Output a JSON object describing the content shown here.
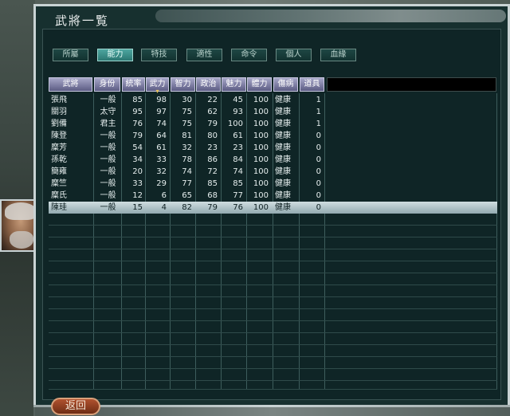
{
  "window": {
    "title": "武將一覧"
  },
  "tabs": [
    {
      "label": "所屬",
      "active": false
    },
    {
      "label": "能力",
      "active": true
    },
    {
      "label": "特技",
      "active": false
    },
    {
      "label": "適性",
      "active": false
    },
    {
      "label": "命令",
      "active": false
    },
    {
      "label": "個人",
      "active": false
    },
    {
      "label": "血緣",
      "active": false
    }
  ],
  "table": {
    "headers": [
      "武將",
      "身份",
      "統率",
      "武力",
      "智力",
      "政治",
      "魅力",
      "體力",
      "傷病",
      "道具"
    ],
    "sorted_column": "武力",
    "rows": [
      {
        "name": "張飛",
        "rank": "一般",
        "lead": "85",
        "war": "98",
        "int": "30",
        "pol": "22",
        "cha": "45",
        "hp": "100",
        "sick": "健康",
        "item": "1"
      },
      {
        "name": "關羽",
        "rank": "太守",
        "lead": "95",
        "war": "97",
        "int": "75",
        "pol": "62",
        "cha": "93",
        "hp": "100",
        "sick": "健康",
        "item": "1"
      },
      {
        "name": "劉備",
        "rank": "君主",
        "lead": "76",
        "war": "74",
        "int": "75",
        "pol": "79",
        "cha": "100",
        "hp": "100",
        "sick": "健康",
        "item": "1"
      },
      {
        "name": "陳登",
        "rank": "一般",
        "lead": "79",
        "war": "64",
        "int": "81",
        "pol": "80",
        "cha": "61",
        "hp": "100",
        "sick": "健康",
        "item": "0"
      },
      {
        "name": "糜芳",
        "rank": "一般",
        "lead": "54",
        "war": "61",
        "int": "32",
        "pol": "23",
        "cha": "23",
        "hp": "100",
        "sick": "健康",
        "item": "0"
      },
      {
        "name": "孫乾",
        "rank": "一般",
        "lead": "34",
        "war": "33",
        "int": "78",
        "pol": "86",
        "cha": "84",
        "hp": "100",
        "sick": "健康",
        "item": "0"
      },
      {
        "name": "簡雍",
        "rank": "一般",
        "lead": "20",
        "war": "32",
        "int": "74",
        "pol": "72",
        "cha": "74",
        "hp": "100",
        "sick": "健康",
        "item": "0"
      },
      {
        "name": "糜竺",
        "rank": "一般",
        "lead": "33",
        "war": "29",
        "int": "77",
        "pol": "85",
        "cha": "85",
        "hp": "100",
        "sick": "健康",
        "item": "0"
      },
      {
        "name": "糜氏",
        "rank": "一般",
        "lead": "12",
        "war": "6",
        "int": "65",
        "pol": "68",
        "cha": "77",
        "hp": "100",
        "sick": "健康",
        "item": "0"
      },
      {
        "name": "陳珪",
        "rank": "一般",
        "lead": "15",
        "war": "4",
        "int": "82",
        "pol": "79",
        "cha": "76",
        "hp": "100",
        "sick": "健康",
        "item": "0",
        "selected": true
      }
    ]
  },
  "buttons": {
    "return_label": "返回"
  },
  "colors": {
    "accent_tab": "#4da6a0",
    "header": "#7c7ca6",
    "selected_row": "#b8c9cd",
    "return_button": "#9a4a28"
  }
}
